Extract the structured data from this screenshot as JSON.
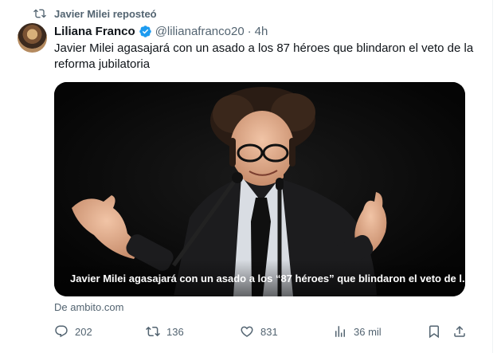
{
  "repost": {
    "label": "Javier Milei reposteó"
  },
  "author": {
    "name": "Liliana Franco",
    "handle": "@lilianafranco20",
    "separator": "·",
    "time": "4h"
  },
  "tweet": {
    "text": "Javier Milei agasajará con un asado a los 87 héroes que blindaron el veto de la reforma jubilatoria"
  },
  "card": {
    "caption": "Javier Milei agasajará con un asado a los “87 héroes” que blindaron el veto de l...",
    "source": "De ambito.com"
  },
  "actions": {
    "replies": "202",
    "reposts": "136",
    "likes": "831",
    "views": "36 mil"
  },
  "colors": {
    "verified": "#1d9bf0",
    "muted": "#536471",
    "text": "#0f1419"
  },
  "icons": {
    "repost_indicator": "repost-icon",
    "verified": "verified-badge-icon",
    "reply": "reply-icon",
    "repost": "repost-icon",
    "like": "heart-icon",
    "views": "views-chart-icon",
    "bookmark": "bookmark-icon",
    "share": "share-icon"
  }
}
